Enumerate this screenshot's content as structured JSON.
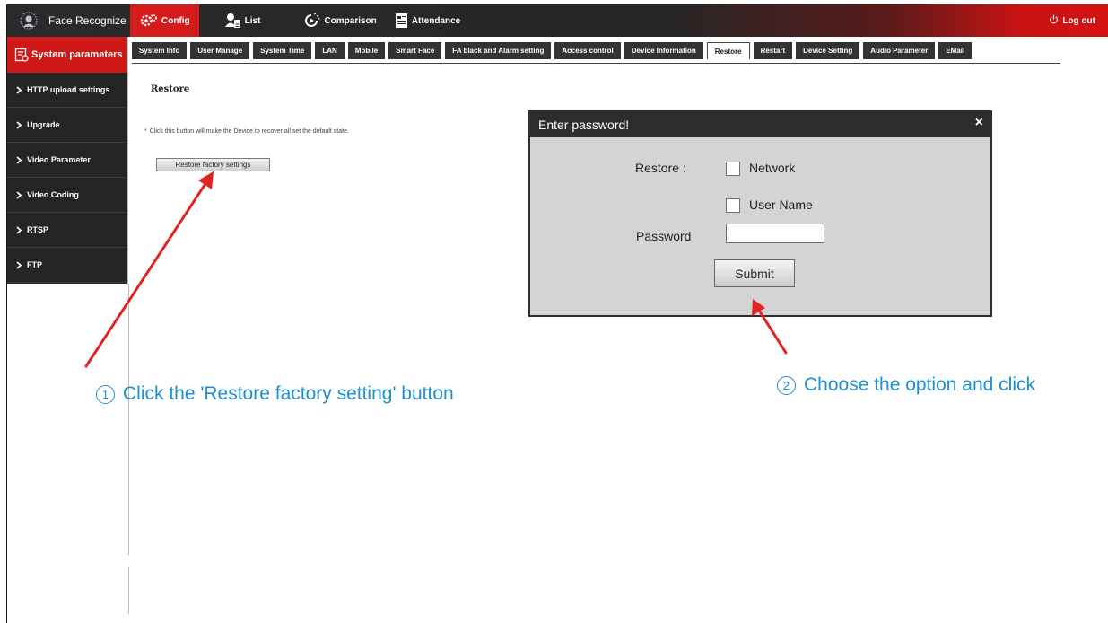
{
  "header": {
    "brand": "Face Recognize",
    "nav": [
      {
        "label": "Config",
        "icon": "gear-icon"
      },
      {
        "label": "List",
        "icon": "user-list-icon"
      },
      {
        "label": "Comparison",
        "icon": "comparison-icon"
      },
      {
        "label": "Attendance",
        "icon": "attendance-icon"
      }
    ],
    "logout": "Log out"
  },
  "sidebar": {
    "title": "System parameters",
    "items": [
      {
        "label": "HTTP upload settings"
      },
      {
        "label": "Upgrade"
      },
      {
        "label": "Video Parameter"
      },
      {
        "label": "Video Coding"
      },
      {
        "label": "RTSP"
      },
      {
        "label": "FTP"
      }
    ]
  },
  "tabs": [
    {
      "label": "System Info"
    },
    {
      "label": "User Manage"
    },
    {
      "label": "System Time"
    },
    {
      "label": "LAN"
    },
    {
      "label": "Mobile"
    },
    {
      "label": "Smart Face"
    },
    {
      "label": "FA black and Alarm setting"
    },
    {
      "label": "Access control"
    },
    {
      "label": "Device Information"
    },
    {
      "label": "Restore"
    },
    {
      "label": "Restart"
    },
    {
      "label": "Device Setting"
    },
    {
      "label": "Audio Parameter"
    },
    {
      "label": "EMail"
    }
  ],
  "active_tab": "Restore",
  "main": {
    "title": "Restore",
    "hint_star": "*",
    "hint": "Click this button will make the Device to recover all set the default state.",
    "restore_button": "Restore factory settings"
  },
  "dialog": {
    "title": "Enter password!",
    "close": "×",
    "restore_label": "Restore :",
    "option_network": "Network",
    "option_username": "User Name",
    "password_label": "Password",
    "password_value": "",
    "submit": "Submit"
  },
  "annotations": {
    "step1_num": "1",
    "step1": "Click the 'Restore factory setting' button",
    "step2_num": "2",
    "step2": "Choose the option and click",
    "arrow_color": "#e32222",
    "text_color": "#1f8fd0"
  },
  "colors": {
    "accent": "#d51c1c",
    "dark": "#252525"
  }
}
